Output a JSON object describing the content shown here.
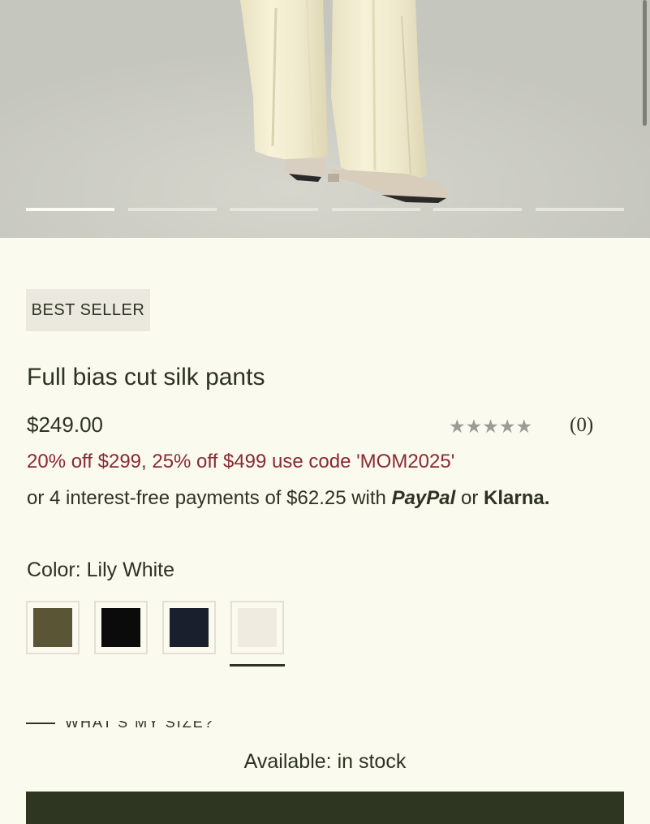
{
  "hero": {
    "alt_subject": "cream silk pants with beige flats",
    "carousel": {
      "count": 6,
      "active_index": 0
    }
  },
  "product": {
    "badge": "BEST SELLER",
    "title": "Full bias cut silk pants",
    "price": "$249.00",
    "rating": {
      "stars_filled": 0,
      "stars_total": 5,
      "review_count": "(0)"
    },
    "promo": "20% off $299, 25% off $499 use code 'MOM2025'",
    "payments": {
      "prefix": "or 4 interest-free payments of $62.25 with",
      "paypal": "PayPal",
      "or": "or",
      "klarna": "Klarna."
    }
  },
  "color": {
    "label": "Color:",
    "selected": "Lily White",
    "swatches": [
      {
        "name": "olive",
        "hex": "#5a5535"
      },
      {
        "name": "black",
        "hex": "#0b0b0b"
      },
      {
        "name": "navy",
        "hex": "#1a1f2e"
      },
      {
        "name": "lily-white",
        "hex": "#efebe0"
      }
    ],
    "selected_index": 3
  },
  "size_guide": {
    "label": "WHAT'S MY SIZE?"
  },
  "availability": "Available: in stock",
  "colors": {
    "background": "#fbfaef",
    "text": "#2d3322",
    "promo": "#8a2a32",
    "button": "#2e3521"
  }
}
